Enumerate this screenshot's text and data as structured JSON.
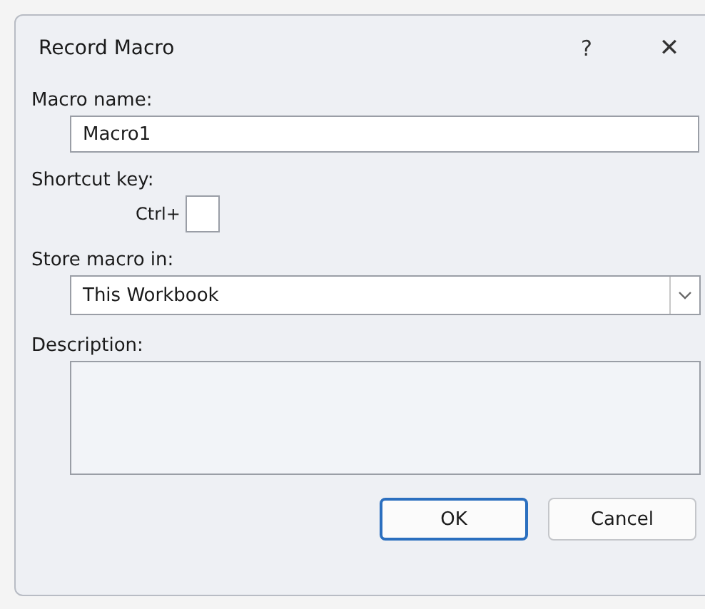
{
  "window": {
    "title": "Record Macro",
    "help": "?",
    "close": "✕"
  },
  "macro_name": {
    "label": "Macro name:",
    "value": "Macro1"
  },
  "shortcut_key": {
    "label": "Shortcut key:",
    "prefix": "Ctrl+"
  },
  "store_macro_in": {
    "label": "Store macro in:",
    "value": "This Workbook"
  },
  "description": {
    "label": "Description:"
  },
  "buttons": [
    {
      "label": "OK",
      "default": true
    },
    {
      "label": "Cancel",
      "default": false
    }
  ]
}
